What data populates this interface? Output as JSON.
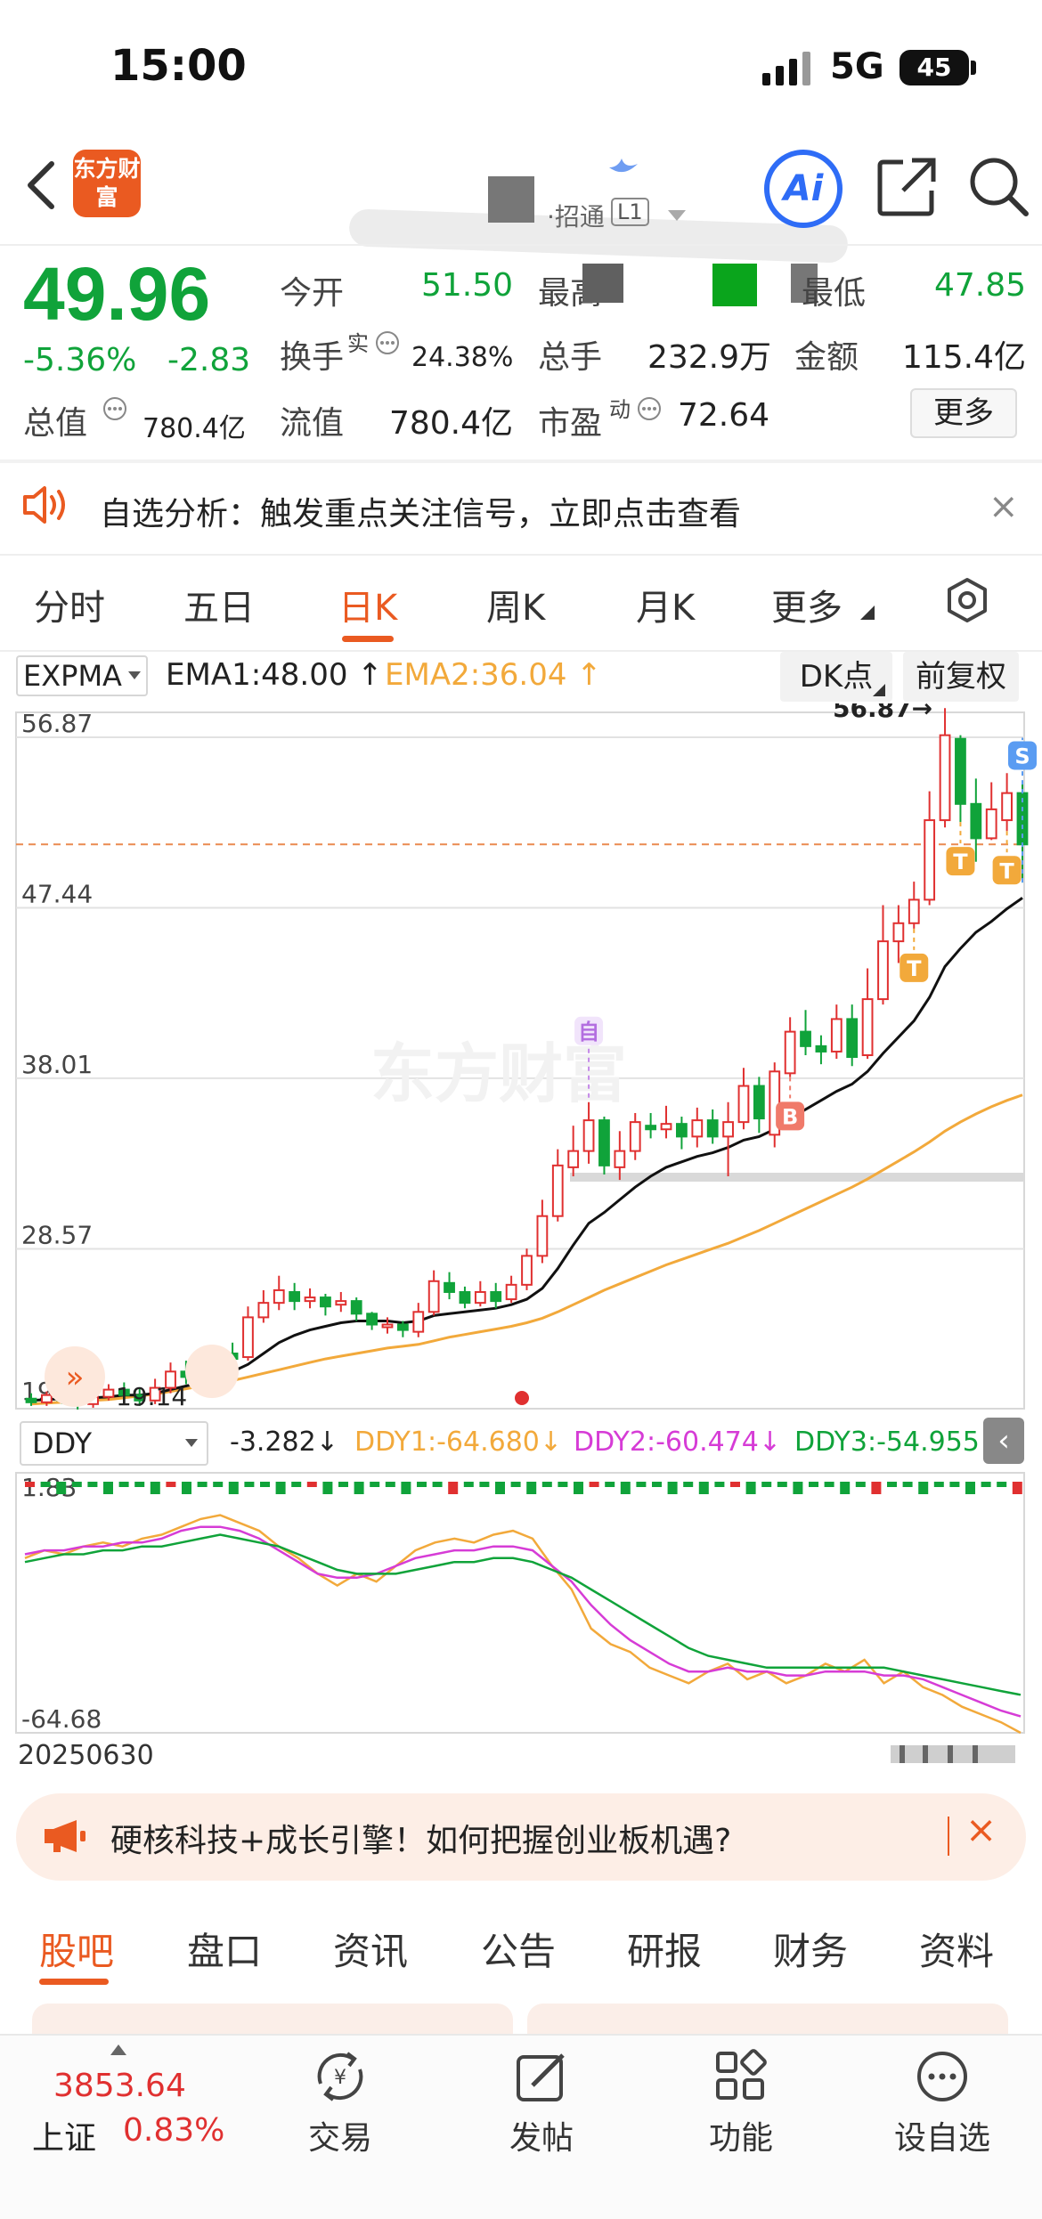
{
  "status_bar": {
    "time": "15:00",
    "network": "5G",
    "battery": "45"
  },
  "header": {
    "logo_text": "东方财富",
    "code_text": "·招通",
    "badge": "L1"
  },
  "quote": {
    "price": "49.96",
    "change_pct": "-5.36%",
    "change": "-2.83",
    "open_label": "今开",
    "open": "51.50",
    "high_label": "最高",
    "low_label": "最低",
    "low": "47.85",
    "turnover_label": "换手",
    "turnover_sup": "实",
    "turnover": "24.38%",
    "volume_label": "总手",
    "volume": "232.9万",
    "amount_label": "金额",
    "amount": "115.4亿",
    "mktcap_label": "总值",
    "mktcap": "780.4亿",
    "float_label": "流值",
    "float_cap": "780.4亿",
    "pe_label": "市盈",
    "pe_sup": "动",
    "pe": "72.64",
    "more_button": "更多"
  },
  "banner": {
    "text": "自选分析：触发重点关注信号，立即点击查看",
    "close": "×"
  },
  "period_tabs": [
    {
      "label": "分时"
    },
    {
      "label": "五日"
    },
    {
      "label": "日K"
    },
    {
      "label": "周K"
    },
    {
      "label": "月K"
    },
    {
      "label": "更多"
    }
  ],
  "indicator": {
    "name": "EXPMA",
    "ema1": "EMA1:48.00",
    "ema2": "EMA2:36.04",
    "dk_button": "DK点",
    "adjust_button": "前复权"
  },
  "chart_data": {
    "type": "candlestick",
    "watermark": "东方财富",
    "y_labels": [
      "56.87",
      "47.44",
      "38.01",
      "28.57",
      "19.14"
    ],
    "ylim": [
      19.14,
      56.87
    ],
    "max_label": "56.87",
    "min_label": "19.14",
    "current_price_line": 49.96,
    "start_date": "20250630",
    "candles": [
      [
        19.3,
        19.1,
        19.6,
        18.9
      ],
      [
        19.1,
        19.5,
        19.7,
        18.9
      ],
      [
        19.4,
        19.2,
        19.8,
        19.0
      ],
      [
        19.2,
        19.0,
        19.5,
        18.7
      ],
      [
        19.0,
        19.4,
        19.7,
        18.8
      ],
      [
        19.4,
        19.8,
        20.1,
        19.2
      ],
      [
        19.8,
        19.5,
        20.2,
        19.3
      ],
      [
        19.5,
        19.2,
        19.9,
        18.9
      ],
      [
        19.2,
        19.9,
        20.4,
        19.0
      ],
      [
        19.9,
        20.8,
        21.3,
        19.6
      ],
      [
        20.8,
        20.5,
        21.4,
        20.1
      ],
      [
        20.5,
        21.3,
        21.8,
        20.3
      ],
      [
        21.3,
        21.8,
        22.2,
        21.0
      ],
      [
        21.8,
        21.5,
        22.4,
        21.1
      ],
      [
        21.6,
        23.8,
        24.4,
        21.4
      ],
      [
        23.8,
        24.6,
        25.3,
        23.5
      ],
      [
        24.6,
        25.3,
        26.1,
        24.2
      ],
      [
        25.2,
        24.7,
        25.7,
        24.2
      ],
      [
        24.7,
        24.9,
        25.4,
        24.3
      ],
      [
        24.9,
        24.4,
        25.1,
        23.9
      ],
      [
        24.5,
        24.7,
        25.2,
        24.1
      ],
      [
        24.7,
        24.0,
        24.9,
        23.6
      ],
      [
        24.0,
        23.4,
        24.1,
        23.1
      ],
      [
        23.4,
        23.4,
        23.8,
        22.9
      ],
      [
        23.4,
        23.1,
        23.6,
        22.7
      ],
      [
        23.0,
        24.1,
        24.6,
        22.7
      ],
      [
        24.1,
        25.8,
        26.4,
        23.9
      ],
      [
        25.7,
        25.2,
        26.3,
        24.8
      ],
      [
        25.2,
        24.6,
        25.5,
        24.3
      ],
      [
        24.6,
        25.2,
        25.8,
        24.4
      ],
      [
        25.2,
        24.7,
        25.7,
        24.3
      ],
      [
        24.8,
        25.6,
        26.1,
        24.6
      ],
      [
        25.6,
        27.2,
        27.6,
        25.3
      ],
      [
        27.2,
        29.4,
        30.3,
        26.8
      ],
      [
        29.4,
        32.2,
        33.1,
        29.1
      ],
      [
        32.1,
        33.0,
        34.4,
        31.6
      ],
      [
        33.0,
        34.7,
        35.7,
        32.3
      ],
      [
        34.7,
        32.2,
        34.9,
        31.7
      ],
      [
        32.1,
        33.0,
        34.1,
        31.4
      ],
      [
        33.0,
        34.6,
        35.1,
        32.5
      ],
      [
        34.4,
        34.2,
        35.1,
        33.7
      ],
      [
        34.2,
        34.5,
        35.5,
        33.7
      ],
      [
        34.5,
        33.8,
        34.9,
        33.1
      ],
      [
        33.8,
        34.7,
        35.4,
        33.2
      ],
      [
        34.7,
        33.8,
        35.3,
        33.4
      ],
      [
        33.8,
        34.6,
        35.7,
        31.6
      ],
      [
        34.6,
        36.6,
        37.6,
        34.2
      ],
      [
        36.6,
        34.8,
        37.1,
        34.0
      ],
      [
        33.9,
        37.4,
        37.9,
        33.2
      ],
      [
        37.3,
        39.6,
        40.4,
        37.1
      ],
      [
        39.6,
        38.8,
        40.8,
        38.3
      ],
      [
        38.8,
        38.5,
        39.4,
        37.8
      ],
      [
        38.5,
        40.3,
        41.1,
        38.1
      ],
      [
        40.3,
        38.2,
        41.1,
        37.7
      ],
      [
        38.3,
        41.4,
        43.1,
        38.1
      ],
      [
        41.4,
        44.6,
        46.6,
        41.1
      ],
      [
        44.6,
        45.6,
        46.6,
        43.4
      ],
      [
        45.6,
        46.9,
        47.9,
        45.3
      ],
      [
        46.9,
        51.3,
        52.9,
        46.6
      ],
      [
        51.3,
        56.0,
        57.5,
        50.9
      ],
      [
        55.8,
        52.2,
        56.0,
        51.2
      ],
      [
        52.2,
        50.3,
        53.6,
        49.0
      ],
      [
        50.3,
        51.9,
        53.4,
        50.2
      ],
      [
        51.3,
        52.8,
        53.9,
        50.7
      ],
      [
        52.8,
        49.96,
        53.4,
        47.85
      ]
    ],
    "ema1": [
      19.2,
      19.25,
      19.3,
      19.3,
      19.35,
      19.4,
      19.5,
      19.5,
      19.6,
      19.8,
      20.0,
      20.2,
      20.5,
      20.8,
      21.2,
      21.8,
      22.4,
      22.8,
      23.1,
      23.3,
      23.5,
      23.6,
      23.6,
      23.6,
      23.5,
      23.6,
      23.9,
      24.0,
      24.1,
      24.2,
      24.3,
      24.5,
      24.8,
      25.4,
      26.5,
      27.8,
      29.0,
      29.6,
      30.3,
      31.0,
      31.6,
      32.1,
      32.4,
      32.7,
      32.9,
      33.2,
      33.6,
      33.8,
      34.2,
      34.8,
      35.3,
      35.8,
      36.3,
      36.7,
      37.4,
      38.4,
      39.3,
      40.2,
      41.5,
      43.2,
      44.2,
      45.1,
      45.7,
      46.4,
      47.0
    ],
    "ema2": [
      19.0,
      19.05,
      19.1,
      19.15,
      19.2,
      19.25,
      19.35,
      19.45,
      19.55,
      19.7,
      19.85,
      20.0,
      20.15,
      20.3,
      20.5,
      20.7,
      20.9,
      21.1,
      21.3,
      21.5,
      21.65,
      21.8,
      21.95,
      22.1,
      22.2,
      22.3,
      22.5,
      22.7,
      22.85,
      23.0,
      23.15,
      23.3,
      23.5,
      23.75,
      24.1,
      24.5,
      24.9,
      25.3,
      25.65,
      26.0,
      26.35,
      26.7,
      27.0,
      27.3,
      27.6,
      27.9,
      28.25,
      28.6,
      29.0,
      29.4,
      29.8,
      30.2,
      30.6,
      31.0,
      31.45,
      31.95,
      32.45,
      32.95,
      33.5,
      34.1,
      34.6,
      35.05,
      35.45,
      35.8,
      36.1
    ],
    "markers": [
      {
        "label": "自",
        "index": 36
      },
      {
        "label": "B",
        "index": 49
      },
      {
        "label": "T",
        "index": 57
      },
      {
        "label": "T",
        "index": 60
      },
      {
        "label": "T",
        "index": 63
      },
      {
        "label": "S",
        "index": 64
      }
    ],
    "ddy": {
      "name": "DDY",
      "value": "-3.282",
      "ddy1": "DDY1:-64.680",
      "ddy2": "DDY2:-60.474",
      "ddy3": "DDY3:-54.955",
      "y_labels": [
        "1.83",
        "-64.68"
      ],
      "ylim": [
        -64.68,
        1.83
      ],
      "ddy1_series": [
        -20,
        -18,
        -19,
        -17,
        -16,
        -17,
        -15,
        -14,
        -12,
        -10,
        -9,
        -11,
        -13,
        -17,
        -20,
        -24,
        -27,
        -24,
        -26,
        -22,
        -18,
        -16,
        -15,
        -16,
        -14,
        -13,
        -15,
        -22,
        -28,
        -38,
        -42,
        -44,
        -48,
        -50,
        -52,
        -49,
        -47,
        -51,
        -49,
        -52,
        -50,
        -47,
        -49,
        -46,
        -52,
        -49,
        -53,
        -55,
        -58,
        -60,
        -62,
        -64.68
      ],
      "ddy2_series": [
        -19,
        -18,
        -18,
        -17,
        -17,
        -16,
        -16,
        -15,
        -13,
        -12,
        -12,
        -13,
        -15,
        -18,
        -21,
        -24,
        -25,
        -25,
        -24,
        -22,
        -20,
        -19,
        -18,
        -18,
        -17,
        -17,
        -18,
        -22,
        -26,
        -32,
        -37,
        -41,
        -44,
        -47,
        -49,
        -49,
        -48,
        -49,
        -49,
        -50,
        -50,
        -49,
        -49,
        -49,
        -50,
        -50,
        -51,
        -53,
        -55,
        -57,
        -59,
        -60.474
      ],
      "ddy3_series": [
        -21,
        -20,
        -19,
        -19,
        -18,
        -18,
        -17,
        -17,
        -16,
        -15,
        -14,
        -15,
        -16,
        -17,
        -19,
        -21,
        -23,
        -24,
        -24,
        -24,
        -23,
        -22,
        -21,
        -21,
        -20,
        -20,
        -21,
        -23,
        -25,
        -28,
        -31,
        -34,
        -37,
        -40,
        -43,
        -45,
        -46,
        -47,
        -48,
        -48,
        -48,
        -48,
        -48,
        -48,
        -48,
        -49,
        -50,
        -51,
        -52,
        -53,
        -54,
        -54.955
      ]
    }
  },
  "promo": {
    "text": "硬核科技+成长引擎！如何把握创业板机遇?"
  },
  "bottom_tabs": [
    {
      "label": "股吧"
    },
    {
      "label": "盘口"
    },
    {
      "label": "资讯"
    },
    {
      "label": "公告"
    },
    {
      "label": "研报"
    },
    {
      "label": "财务"
    },
    {
      "label": "资料"
    }
  ],
  "bottom_nav": {
    "index_value": "3853.64",
    "index_name": "上证",
    "index_pct": "0.83%",
    "items": [
      {
        "label": "交易"
      },
      {
        "label": "发帖"
      },
      {
        "label": "功能"
      },
      {
        "label": "设自选"
      }
    ]
  },
  "colors": {
    "accent": "#ea5a21",
    "down": "#10a33a",
    "up": "#e03030",
    "ema2": "#f2a93b",
    "ddy2": "#d63cd6"
  }
}
